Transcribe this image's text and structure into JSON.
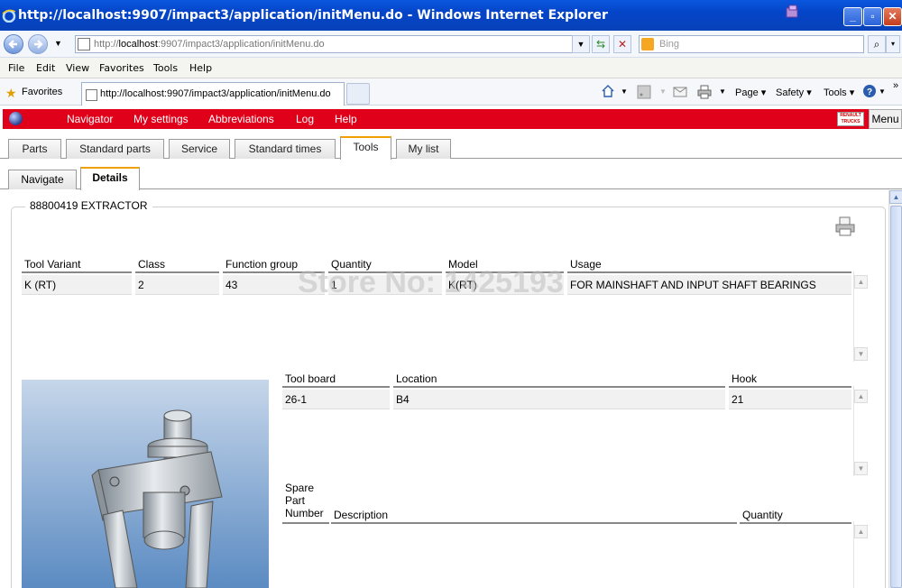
{
  "window": {
    "title": "http://localhost:9907/impact3/application/initMenu.do - Windows Internet Explorer"
  },
  "address_bar": {
    "url_prefix": "http://",
    "url_host": "localhost",
    "url_rest": ":9907/impact3/application/initMenu.do",
    "search_placeholder": "Bing"
  },
  "menu_bar": [
    "File",
    "Edit",
    "View",
    "Favorites",
    "Tools",
    "Help"
  ],
  "favorites_bar": {
    "favorites_label": "Favorites",
    "tab_title": "http://localhost:9907/impact3/application/initMenu.do",
    "commands": [
      "Page ▾",
      "Safety ▾",
      "Tools ▾"
    ]
  },
  "app_bar": {
    "nav": [
      "Navigator",
      "My settings",
      "Abbreviations",
      "Log",
      "Help"
    ],
    "menu_label": "Menu",
    "brand_text": "RENAULT TRUCKS"
  },
  "top_tabs": [
    "Parts",
    "Standard parts",
    "Service",
    "Standard times",
    "Tools",
    "My list"
  ],
  "top_tabs_active": "Tools",
  "sub_tabs": [
    "Navigate",
    "Details"
  ],
  "sub_tabs_active": "Details",
  "details": {
    "legend": "88800419 EXTRACTOR",
    "variant_table": {
      "headers": [
        "Tool Variant",
        "Class",
        "Function group",
        "Quantity",
        "Model",
        "Usage"
      ],
      "rows": [
        [
          "K (RT)",
          "2",
          "43",
          "1",
          "K(RT)",
          "FOR MAINSHAFT AND INPUT SHAFT BEARINGS"
        ]
      ]
    },
    "board_table": {
      "headers": [
        "Tool board",
        "Location",
        "Hook"
      ],
      "rows": [
        [
          "26-1",
          "B4",
          "21"
        ]
      ]
    },
    "spare_table": {
      "headers": [
        "Spare Part Number",
        "Description",
        "Quantity"
      ],
      "spare_header_lines": [
        "Spare",
        "Part",
        "Number"
      ],
      "rows": []
    }
  },
  "watermark": "Store No: 1425193"
}
